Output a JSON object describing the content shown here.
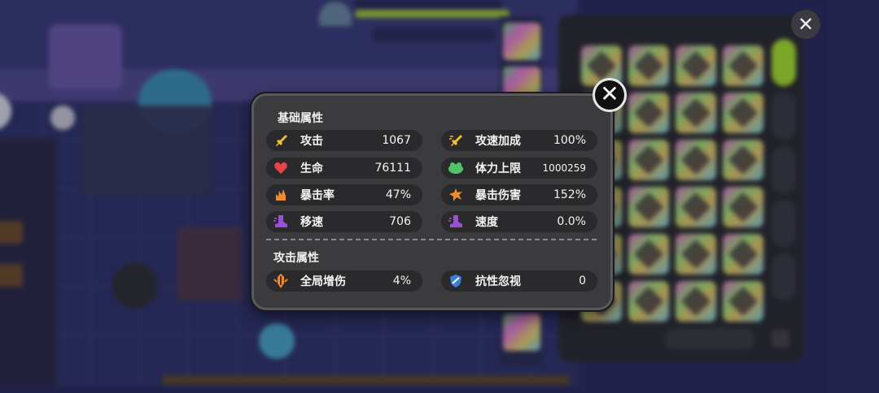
{
  "dialog": {
    "basic_title": "基础属性",
    "attack_title": "攻击属性",
    "close_symbol": "✕",
    "basic_stats": [
      {
        "label": "攻击",
        "value": "1067",
        "icon": "sword-icon",
        "color": "#f2c12e"
      },
      {
        "label": "攻速加成",
        "value": "100%",
        "icon": "speed-sword-icon",
        "color": "#f2c12e"
      },
      {
        "label": "生命",
        "value": "76111",
        "icon": "heart-icon",
        "color": "#e8434a"
      },
      {
        "label": "体力上限",
        "value": "1000259",
        "icon": "stamina-icon",
        "color": "#4fc46b"
      },
      {
        "label": "暴击率",
        "value": "47%",
        "icon": "crit-rate-icon",
        "color": "#f28a2e"
      },
      {
        "label": "暴击伤害",
        "value": "152%",
        "icon": "crit-damage-icon",
        "color": "#f28a2e"
      },
      {
        "label": "移速",
        "value": "706",
        "icon": "boot-icon",
        "color": "#9b4fd6"
      },
      {
        "label": "速度",
        "value": "0.0%",
        "icon": "boot-icon",
        "color": "#9b4fd6"
      }
    ],
    "attack_stats": [
      {
        "label": "全局增伤",
        "value": "4%",
        "icon": "damage-boost-icon",
        "color": "#f28a2e"
      },
      {
        "label": "抗性忽视",
        "value": "0",
        "icon": "shield-icon",
        "color": "#3a7fd9"
      }
    ]
  },
  "background": {
    "close_symbol": "✕",
    "accent_color": "#a8e22f"
  }
}
